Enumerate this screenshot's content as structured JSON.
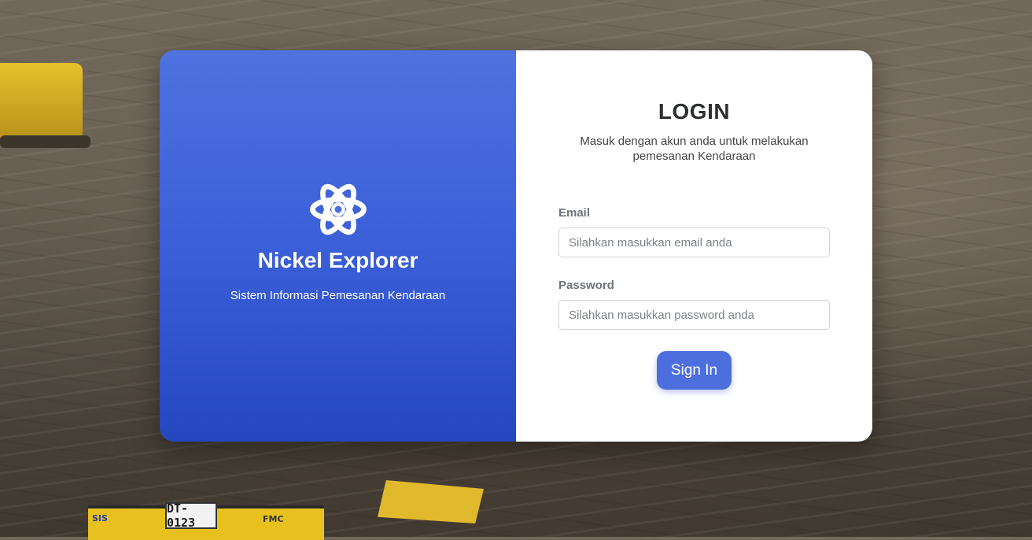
{
  "brand": {
    "title": "Nickel Explorer",
    "subtitle": "Sistem Informasi Pemesanan Kendaraan",
    "icon": "atom-icon"
  },
  "login": {
    "title": "LOGIN",
    "subtitle": "Masuk dengan akun anda untuk melakukan pemesanan Kendaraan",
    "email_label": "Email",
    "email_placeholder": "Silahkan masukkan email anda",
    "password_label": "Password",
    "password_placeholder": "Silahkan masukkan password anda",
    "submit_label": "Sign In"
  },
  "background": {
    "truck_plate": "DT-0123",
    "truck_code": "FMC",
    "truck_brand": "SIS"
  },
  "colors": {
    "accent": "#4d6fde",
    "panel_top": "#4e72e0",
    "panel_bottom": "#2447bf"
  }
}
